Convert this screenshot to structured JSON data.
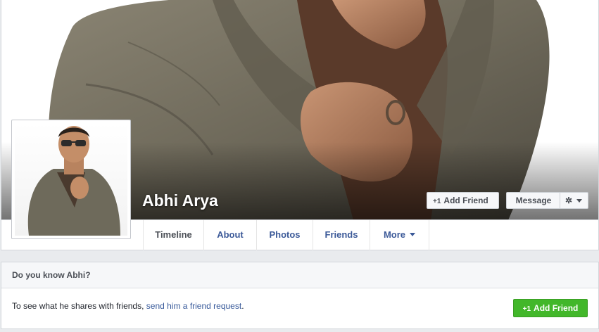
{
  "profile": {
    "name": "Abhi Arya"
  },
  "actions": {
    "add_friend_label": "Add Friend",
    "add_friend_prefix": "+1",
    "message_label": "Message",
    "settings_icon": "gear-icon"
  },
  "tabs": [
    {
      "label": "Timeline",
      "active": true
    },
    {
      "label": "About"
    },
    {
      "label": "Photos"
    },
    {
      "label": "Friends"
    },
    {
      "label": "More"
    }
  ],
  "know_box": {
    "title": "Do you know Abhi?",
    "text": "To see what he shares with friends,",
    "link": "send him a friend request",
    "period": ".",
    "button_prefix": "+1",
    "button_label": "Add Friend"
  },
  "colors": {
    "link": "#3b5998",
    "green_button": "#42b72a"
  }
}
